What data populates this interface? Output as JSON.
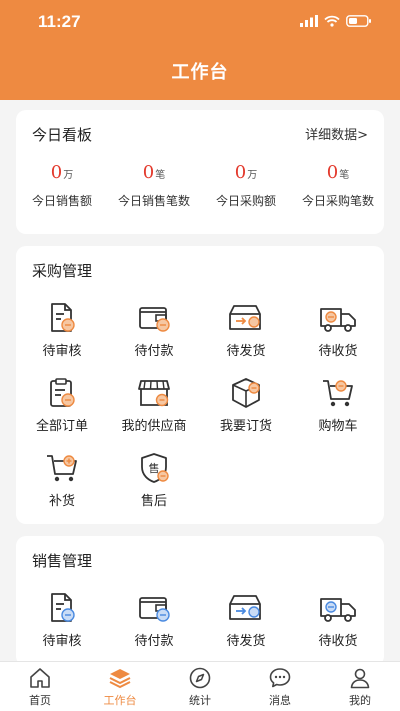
{
  "status": {
    "time": "11:27"
  },
  "header": {
    "title": "工作台"
  },
  "kanban": {
    "title": "今日看板",
    "detail_link": "详细数据>",
    "stats": [
      {
        "value": "0",
        "unit": "万",
        "label": "今日销售额"
      },
      {
        "value": "0",
        "unit": "笔",
        "label": "今日销售笔数"
      },
      {
        "value": "0",
        "unit": "万",
        "label": "今日采购额"
      },
      {
        "value": "0",
        "unit": "笔",
        "label": "今日采购笔数"
      }
    ]
  },
  "purchase": {
    "title": "采购管理",
    "items": [
      {
        "label": "待审核",
        "icon": "document-review-icon"
      },
      {
        "label": "待付款",
        "icon": "wallet-icon"
      },
      {
        "label": "待发货",
        "icon": "ship-box-icon"
      },
      {
        "label": "待收货",
        "icon": "delivery-truck-icon"
      },
      {
        "label": "全部订单",
        "icon": "clipboard-order-icon"
      },
      {
        "label": "我的供应商",
        "icon": "storefront-icon"
      },
      {
        "label": "我要订货",
        "icon": "package-icon"
      },
      {
        "label": "购物车",
        "icon": "shopping-cart-icon"
      },
      {
        "label": "补货",
        "icon": "restock-cart-icon"
      },
      {
        "label": "售后",
        "icon": "after-sales-shield-icon"
      }
    ]
  },
  "sales": {
    "title": "销售管理",
    "items": [
      {
        "label": "待审核",
        "icon": "document-review-icon"
      },
      {
        "label": "待付款",
        "icon": "wallet-icon"
      },
      {
        "label": "待发货",
        "icon": "ship-box-icon"
      },
      {
        "label": "待收货",
        "icon": "delivery-truck-icon"
      }
    ]
  },
  "tabbar": {
    "items": [
      {
        "label": "首页",
        "icon": "home-icon",
        "active": false
      },
      {
        "label": "工作台",
        "icon": "layers-icon",
        "active": true
      },
      {
        "label": "统计",
        "icon": "compass-icon",
        "active": false
      },
      {
        "label": "消息",
        "icon": "chat-bubble-icon",
        "active": false
      },
      {
        "label": "我的",
        "icon": "user-icon",
        "active": false
      }
    ]
  },
  "colors": {
    "accent": "#ee8a41",
    "stat_number": "#e33a2d",
    "icon_stroke": "#333333"
  },
  "glyphs": {
    "after_sales": "售"
  }
}
